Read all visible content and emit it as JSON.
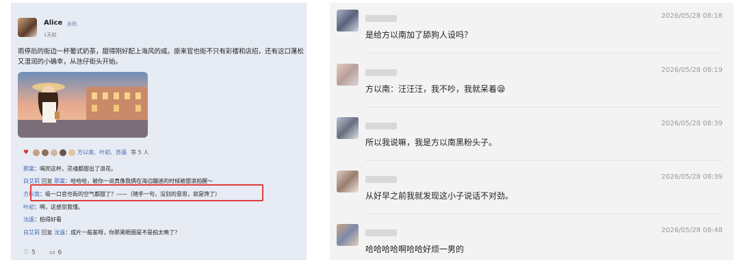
{
  "left_post": {
    "username": "Alice",
    "tag": "自拍",
    "time": "1天前",
    "body": "雨停后的街边一杯葡式奶茶，甜得刚好配上海风的咸。原来官也街不只有彩楼和店招，还有这口蓬松又湿润的小确幸，从氹仔街头开始。",
    "likers": "方以南、叶初、苏遥",
    "likers_more": "等 5 人",
    "comments": [
      {
        "name": "那棠",
        "sep": "：",
        "text": "喝完这杯，灵魂都甜出了浪花。"
      },
      {
        "name": "白艾莉",
        "reply": " 回复 ",
        "to": "那棠",
        "sep": "：",
        "text": "哈哈哈，被你一说真像我俩在海边蹦迪的时候被甜浪拍醒～"
      },
      {
        "name": "方以南",
        "sep": "：",
        "text": "吸一口官也街的空气都甜了？——（随手一句，没别的意思，就是馋了）"
      },
      {
        "name": "叶初",
        "sep": "：",
        "text": "啊，这感觉我懂。"
      },
      {
        "name": "沈遥",
        "sep": "：",
        "text": "拍得好看"
      },
      {
        "name": "白艾莉",
        "reply": " 回复 ",
        "to": "沈遥",
        "sep": "：",
        "text": "成片一般差呀，你那黑眼圈是不是拍太晚了？"
      }
    ],
    "like_count": "5",
    "comment_count": "6"
  },
  "right_chat": {
    "items": [
      {
        "date": "2026/05/28 08:18",
        "text": "是给方以南加了舔狗人设吗？"
      },
      {
        "date": "2026/05/28 08:19",
        "text": "方以南：汪汪汪，我不吵，我就呆着😪"
      },
      {
        "date": "2026/05/28 08:39",
        "text": "所以我说嘛，我是方以南黑粉头子。"
      },
      {
        "date": "2026/05/28 08:39",
        "text": "从好早之前我就发现这小子说话不对劲。"
      },
      {
        "date": "2026/05/28 08:48",
        "text": "哈哈哈哈啊哈哈好烦一男的"
      }
    ]
  },
  "colors": {
    "highlight": "#e03a3a",
    "name_link": "#3e64b5",
    "left_bg": "#e6ebf4",
    "right_bg": "#f3f3f3"
  }
}
